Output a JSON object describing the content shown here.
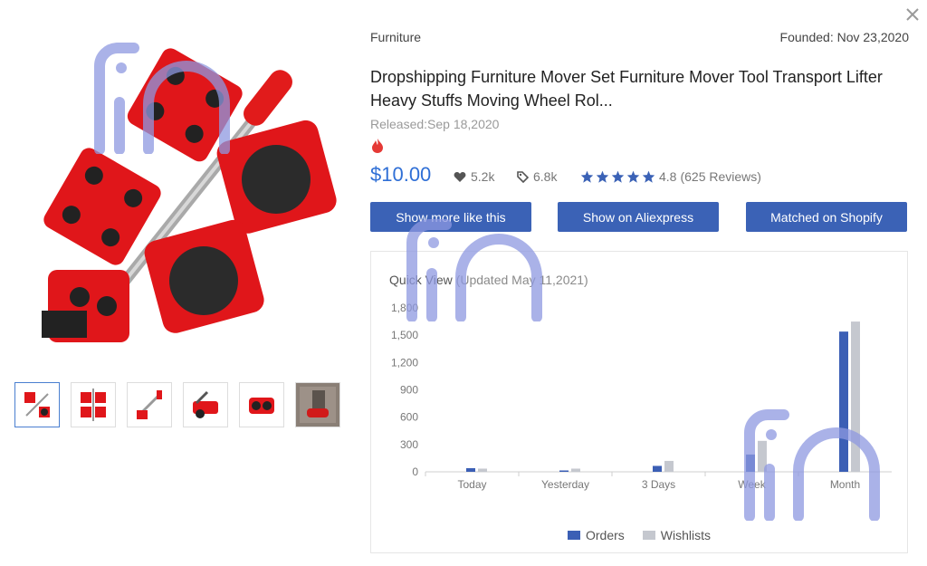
{
  "header": {
    "category": "Furniture",
    "founded": "Founded: Nov 23,2020",
    "close_icon": "close-icon"
  },
  "product": {
    "title": "Dropshipping Furniture Mover Set Furniture Mover Tool Transport Lifter Heavy Stuffs Moving Wheel Rol...",
    "released": "Released:Sep 18,2020",
    "price": "$10.00",
    "likes": "5.2k",
    "tags": "6.8k",
    "rating": "4.8",
    "reviews": "(625 Reviews)",
    "stars": 5
  },
  "buttons": {
    "show_more": "Show more like this",
    "aliexpress": "Show on Aliexpress",
    "shopify": "Matched on Shopify"
  },
  "gallery": {
    "thumbnail_count": 6,
    "active_index": 0
  },
  "quick_view": {
    "title": "Quick View",
    "updated": "(Updated May 11,2021)"
  },
  "colors": {
    "accent": "#2f6fd6",
    "button": "#3b62b6",
    "orders": "#3b5fb5",
    "wishlists": "#c5c8cf",
    "star": "#3b62b6",
    "hot": "#e53935"
  },
  "chart_data": {
    "type": "bar",
    "categories": [
      "Today",
      "Yesterday",
      "3 Days",
      "Week",
      "Month"
    ],
    "series": [
      {
        "name": "Orders",
        "values": [
          40,
          15,
          65,
          190,
          1540
        ]
      },
      {
        "name": "Wishlists",
        "values": [
          35,
          35,
          120,
          340,
          1650
        ]
      }
    ],
    "ylim": [
      0,
      1800
    ],
    "yticks": [
      "0",
      "300",
      "600",
      "900",
      "1,200",
      "1,500",
      "1,800"
    ],
    "legend": "bottom-center",
    "grid": false
  }
}
